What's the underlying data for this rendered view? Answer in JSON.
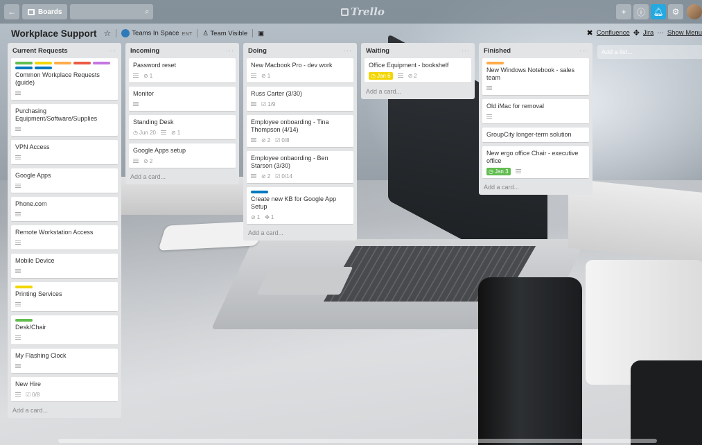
{
  "header": {
    "back_icon": "back-arrow-icon",
    "boards_label": "Boards",
    "search_icon": "search-icon",
    "logo": "Trello",
    "right_icons": [
      "plus-icon",
      "info-icon",
      "bell-icon",
      "gear-icon"
    ]
  },
  "board": {
    "title": "Workplace Support",
    "team": "Teams In Space",
    "team_badge": "ENT",
    "visibility": "Team Visible",
    "powerups": [
      {
        "label": "Confluence"
      },
      {
        "label": "Jira"
      }
    ],
    "show_menu": "Show Menu",
    "add_list": "Add a list..."
  },
  "colors": {
    "green": "#61bd4f",
    "yellow": "#f2d600",
    "orange": "#ffab4a",
    "red": "#eb5a46",
    "purple": "#c377e0",
    "blue": "#0079bf",
    "due_yellow": "#f2d600",
    "due_green": "#61bd4f"
  },
  "lists": [
    {
      "name": "Current Requests",
      "add_card": "Add a card...",
      "cards": [
        {
          "title": "Common Workplace Requests (guide)",
          "labels": [
            "green",
            "yellow",
            "orange",
            "red",
            "purple",
            "blue",
            "blue"
          ],
          "desc": true
        },
        {
          "title": "Purchasing Equipment/Software/Supplies",
          "desc": true
        },
        {
          "title": "VPN Access",
          "desc": true
        },
        {
          "title": "Google Apps",
          "desc": true
        },
        {
          "title": "Phone.com",
          "desc": true
        },
        {
          "title": "Remote Workstation Access",
          "desc": true
        },
        {
          "title": "Mobile Device",
          "desc": true
        },
        {
          "title": "Printing Services",
          "labels": [
            "yellow"
          ],
          "desc": true
        },
        {
          "title": "Desk/Chair",
          "labels": [
            "green"
          ],
          "desc": true
        },
        {
          "title": "My Flashing Clock",
          "desc": true
        },
        {
          "title": "New Hire",
          "desc": true,
          "checklist": "0/8"
        }
      ]
    },
    {
      "name": "Incoming",
      "add_card": "Add a card...",
      "cards": [
        {
          "title": "Password reset",
          "desc": true,
          "attachments": "1"
        },
        {
          "title": "Monitor",
          "desc": true
        },
        {
          "title": "Standing Desk",
          "due": "Jun 20",
          "desc": true,
          "attachments": "1"
        },
        {
          "title": "Google Apps setup",
          "desc": true,
          "attachments": "2"
        }
      ]
    },
    {
      "name": "Doing",
      "add_card": "Add a card...",
      "cards": [
        {
          "title": "New Macbook Pro - dev work",
          "desc": true,
          "attachments": "1"
        },
        {
          "title": "Russ Carter (3/30)",
          "desc": true,
          "checklist": "1/9"
        },
        {
          "title": "Employee onboarding - Tina Thompson (4/14)",
          "desc": true,
          "attachments": "2",
          "checklist": "0/8"
        },
        {
          "title": "Employee onbaording - Ben Starson (3/30)",
          "desc": true,
          "attachments": "2",
          "checklist": "0/14"
        },
        {
          "title": "Create new KB for Google App Setup",
          "labels": [
            "blue"
          ],
          "attachments": "1",
          "jira": "1"
        }
      ]
    },
    {
      "name": "Waiting",
      "add_card": "Add a card...",
      "cards": [
        {
          "title": "Office Equipment - bookshelf",
          "due": "Jan 6",
          "due_style": "yellow",
          "desc": true,
          "attachments": "2"
        }
      ]
    },
    {
      "name": "Finished",
      "add_card": "Add a card...",
      "cards": [
        {
          "title": "New Windows Notebook - sales team",
          "labels": [
            "orange"
          ],
          "desc": true
        },
        {
          "title": "Old iMac for removal",
          "desc": true
        },
        {
          "title": "GroupCity longer-term solution"
        },
        {
          "title": "New ergo office Chair - executive office",
          "due": "Jan 3",
          "due_style": "green",
          "desc": true
        }
      ]
    }
  ]
}
